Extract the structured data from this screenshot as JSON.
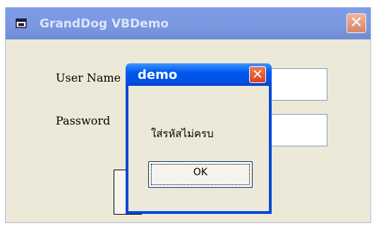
{
  "main_window": {
    "title": "GrandDog VBDemo",
    "close_glyph": "✕",
    "labels": {
      "username": "User Name",
      "password": "Password"
    },
    "icon": "app-window-icon"
  },
  "dialog": {
    "title": "demo",
    "close_glyph": "✕",
    "message": "ใส่รหัสไม่ครบ",
    "ok_label": "OK"
  }
}
